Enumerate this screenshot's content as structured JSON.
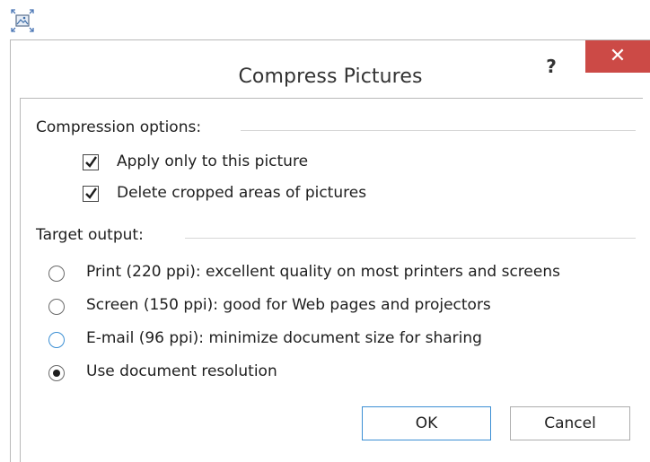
{
  "window": {
    "title": "Compress Pictures",
    "help_label": "?",
    "close_label": "✕"
  },
  "compression": {
    "group_label": "Compression options:",
    "options": [
      {
        "label": "Apply only to this picture",
        "checked": true
      },
      {
        "label": "Delete cropped areas of pictures",
        "checked": true
      }
    ]
  },
  "target": {
    "group_label": "Target output:",
    "options": [
      {
        "label": "Print (220 ppi): excellent quality on most printers and screens",
        "selected": false
      },
      {
        "label": "Screen (150 ppi): good for Web pages and projectors",
        "selected": false
      },
      {
        "label": "E-mail (96 ppi): minimize document size for sharing",
        "selected": false
      },
      {
        "label": "Use document resolution",
        "selected": true
      }
    ]
  },
  "buttons": {
    "ok": "OK",
    "cancel": "Cancel"
  },
  "colors": {
    "close_bg": "#cc4a46",
    "focus_blue": "#3c8fd4"
  },
  "icons": {
    "corner": "picture-compress-icon",
    "check": "checkmark-icon"
  }
}
